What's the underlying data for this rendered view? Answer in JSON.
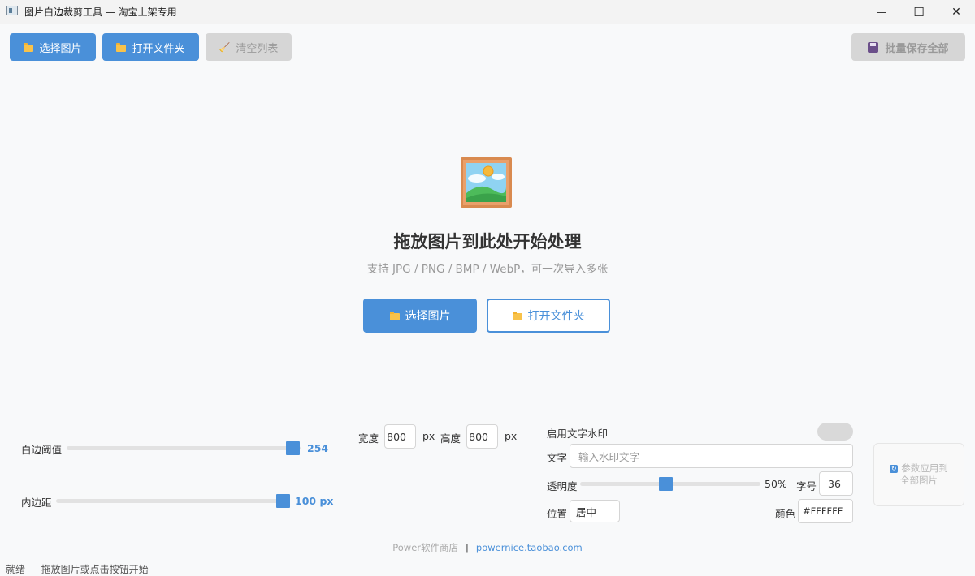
{
  "window": {
    "title": "图片白边裁剪工具 — 淘宝上架专用",
    "minimize_glyph": "—",
    "maximize_glyph": "☐",
    "close_glyph": "✕"
  },
  "toolbar": {
    "select_images_label": "选择图片",
    "open_folder_label": "打开文件夹",
    "clear_list_label": "清空列表",
    "batch_save_label": "批量保存全部"
  },
  "drop_area": {
    "title": "拖放图片到此处开始处理",
    "subtitle": "支持 JPG / PNG / BMP / WebP，可一次导入多张",
    "select_images_label": "选择图片",
    "open_folder_label": "打开文件夹"
  },
  "settings": {
    "threshold": {
      "label": "白边阈值",
      "value": "254",
      "fraction": 0.99
    },
    "padding": {
      "label": "内边距",
      "value": "100 px",
      "fraction": 0.99
    },
    "width": {
      "label": "宽度",
      "value": "800",
      "unit": "px"
    },
    "height": {
      "label": "高度",
      "value": "800",
      "unit": "px"
    },
    "watermark": {
      "enable_label": "启用文字水印",
      "enabled": false,
      "text_label": "文字",
      "text_placeholder": "输入水印文字",
      "opacity_label": "透明度",
      "opacity_value": "50%",
      "opacity_fraction": 0.5,
      "font_size_label": "字号",
      "font_size_value": "36",
      "position_label": "位置",
      "position_value": "居中",
      "color_label": "颜色",
      "color_value": "#FFFFFF"
    },
    "apply_all_label_1": "参数应用到",
    "apply_all_label_2": "全部图片"
  },
  "footer": {
    "shop_name": "Power软件商店",
    "separator": "|",
    "shop_url": "powernice.taobao.com"
  },
  "status_bar": {
    "text": "就绪 — 拖放图片或点击按钮开始"
  },
  "colors": {
    "accent": "#4a90d9",
    "disabled_bg": "#d6d6d6",
    "background": "#f8f9fa"
  },
  "icons": {
    "folder": "folder-icon",
    "broom": "broom-icon",
    "save": "floppy-disk-icon",
    "picture": "framed-picture-icon",
    "refresh": "refresh-icon"
  }
}
